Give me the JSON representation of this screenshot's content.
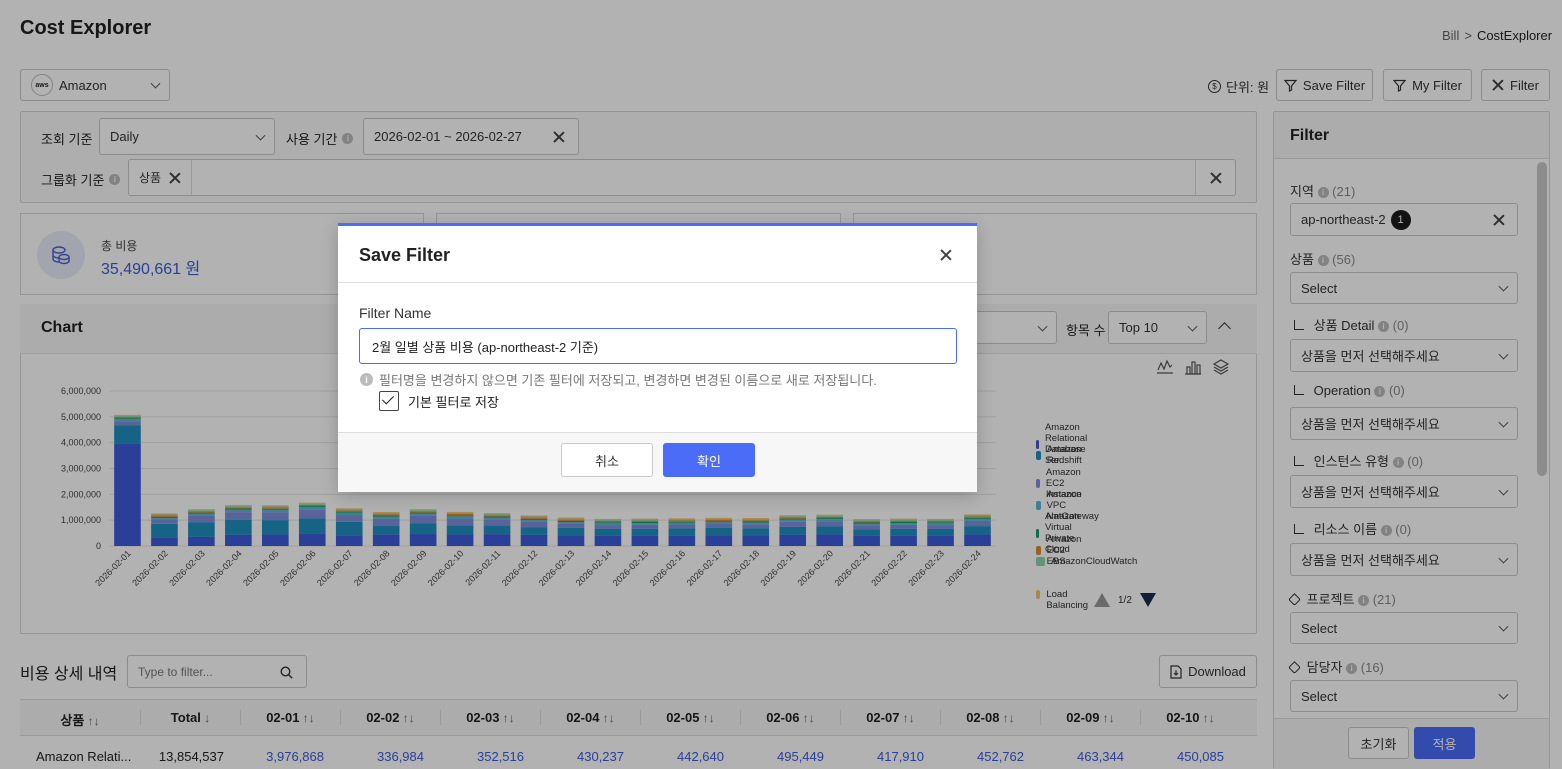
{
  "page": {
    "title": "Cost Explorer",
    "breadcrumb": [
      "Bill",
      ">",
      "CostExplorer"
    ]
  },
  "toolbar": {
    "account": "Amazon",
    "unit_label": "단위: 원",
    "save_filter": "Save Filter",
    "my_filter": "My Filter",
    "filter": "Filter"
  },
  "query": {
    "basis_label": "조회 기준",
    "basis_value": "Daily",
    "period_label": "사용 기간",
    "period_value": "2026-02-01 ~ 2026-02-27",
    "group_label": "그룹화 기준",
    "group_tag": "상품"
  },
  "summary": {
    "label": "총 비용",
    "value": "35,490,661 원"
  },
  "chart_panel": {
    "title": "Chart",
    "items_label": "항목 수",
    "items_value": "Top 10",
    "page": "1/2"
  },
  "chart_data": {
    "type": "bar",
    "stacked": true,
    "categories": [
      "2026-02-01",
      "2026-02-02",
      "2026-02-03",
      "2026-02-04",
      "2026-02-05",
      "2026-02-06",
      "2026-02-07",
      "2026-02-08",
      "2026-02-09",
      "2026-02-10",
      "2026-02-11",
      "2026-02-12",
      "2026-02-13",
      "2026-02-14",
      "2026-02-15",
      "2026-02-16",
      "2026-02-17",
      "2026-02-18",
      "2026-02-19",
      "2026-02-20",
      "2026-02-21",
      "2026-02-22",
      "2026-02-23",
      "2026-02-24"
    ],
    "y_ticks": [
      "6,000,000",
      "5,000,000",
      "4,000,000",
      "3,000,000",
      "2,000,000",
      "1,000,000",
      "0"
    ],
    "ylim": [
      0,
      6000000
    ],
    "series": [
      {
        "name": "Amazon Relational Database Ser...",
        "color": "#3d5bd9",
        "values": [
          3976868,
          336984,
          352516,
          430237,
          442640,
          495449,
          417910,
          452762,
          463344,
          450085,
          460000,
          430000,
          420000,
          400000,
          400000,
          400000,
          410000,
          420000,
          440000,
          450000,
          400000,
          400000,
          400000,
          450000
        ]
      },
      {
        "name": "Amazon Redshift",
        "color": "#1f8fbf",
        "values": [
          700000,
          520000,
          560000,
          580000,
          560000,
          580000,
          520000,
          320000,
          420000,
          350000,
          330000,
          300000,
          280000,
          260000,
          270000,
          280000,
          290000,
          270000,
          300000,
          310000,
          250000,
          270000,
          260000,
          320000
        ]
      },
      {
        "name": "Amazon EC2 Instance",
        "color": "#7f8fe0",
        "values": [
          150000,
          150000,
          250000,
          300000,
          300000,
          330000,
          260000,
          280000,
          280000,
          260000,
          230000,
          200000,
          160000,
          150000,
          150000,
          150000,
          150000,
          150000,
          200000,
          200000,
          150000,
          150000,
          150000,
          200000
        ]
      },
      {
        "name": "Amazon VPC NatGateway",
        "color": "#5cb8d6",
        "values": [
          80000,
          80000,
          90000,
          100000,
          100000,
          100000,
          90000,
          90000,
          90000,
          90000,
          80000,
          80000,
          70000,
          70000,
          70000,
          70000,
          70000,
          70000,
          80000,
          80000,
          70000,
          70000,
          70000,
          80000
        ]
      },
      {
        "name": "Amazon Virtual Private Cloud",
        "color": "#16a06a",
        "values": [
          40000,
          40000,
          40000,
          40000,
          40000,
          40000,
          40000,
          40000,
          40000,
          40000,
          40000,
          40000,
          40000,
          40000,
          40000,
          40000,
          40000,
          40000,
          40000,
          40000,
          40000,
          40000,
          40000,
          40000
        ]
      },
      {
        "name": "Amazon EC2 EBS",
        "color": "#e08a2e",
        "values": [
          50000,
          50000,
          50000,
          50000,
          50000,
          50000,
          50000,
          50000,
          50000,
          50000,
          50000,
          50000,
          50000,
          50000,
          50000,
          50000,
          50000,
          50000,
          50000,
          50000,
          50000,
          50000,
          50000,
          50000
        ]
      },
      {
        "name": "AmazonCloudWatch",
        "color": "#8fd3b0",
        "values": [
          40000,
          40000,
          40000,
          40000,
          40000,
          40000,
          40000,
          40000,
          40000,
          40000,
          40000,
          40000,
          40000,
          40000,
          40000,
          40000,
          40000,
          40000,
          40000,
          40000,
          40000,
          40000,
          40000,
          40000
        ]
      },
      {
        "name": "Elastic Load Balancing",
        "color": "#f2c26b",
        "values": [
          40000,
          40000,
          40000,
          40000,
          40000,
          40000,
          40000,
          40000,
          40000,
          40000,
          40000,
          40000,
          40000,
          40000,
          40000,
          40000,
          40000,
          40000,
          40000,
          40000,
          40000,
          40000,
          40000,
          40000
        ]
      }
    ]
  },
  "detail": {
    "title": "비용 상세 내역",
    "filter_placeholder": "Type to filter...",
    "download": "Download",
    "headers": [
      "상품",
      "Total",
      "02-01",
      "02-02",
      "02-03",
      "02-04",
      "02-05",
      "02-06",
      "02-07",
      "02-08",
      "02-09",
      "02-10"
    ],
    "row": [
      "Amazon Relati...",
      "13,854,537",
      "3,976,868",
      "336,984",
      "352,516",
      "430,237",
      "442,640",
      "495,449",
      "417,910",
      "452,762",
      "463,344",
      "450,085"
    ]
  },
  "filter_panel": {
    "title": "Filter",
    "region_label": "지역",
    "region_count": "(21)",
    "region_value": "ap-northeast-2",
    "region_badge": "1",
    "product_label": "상품",
    "product_count": "(56)",
    "product_value": "Select",
    "detail_label": "상품 Detail",
    "detail_count": "(0)",
    "operation_label": "Operation",
    "operation_count": "(0)",
    "instance_label": "인스턴스 유형",
    "instance_count": "(0)",
    "resource_label": "리소스 이름",
    "resource_count": "(0)",
    "placeholder_dependent": "상품을 먼저 선택해주세요",
    "project_label": "프로젝트",
    "project_count": "(21)",
    "project_value": "Select",
    "owner_label": "담당자",
    "owner_count": "(16)",
    "owner_value": "Select",
    "reset": "초기화",
    "apply": "적용"
  },
  "modal": {
    "title": "Save Filter",
    "field_label": "Filter Name",
    "field_value": "2월 일별 상품 비용 (ap-northeast-2 기준)",
    "hint": "필터명을 변경하지 않으면 기존 필터에 저장되고, 변경하면 변경된 이름으로 새로 저장됩니다.",
    "checkbox_label": "기본 필터로 저장",
    "cancel": "취소",
    "confirm": "확인"
  }
}
